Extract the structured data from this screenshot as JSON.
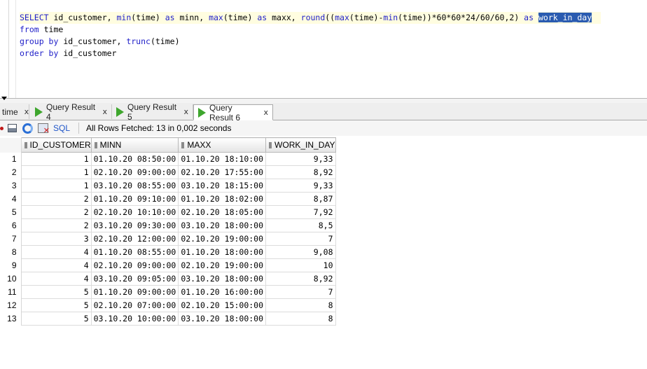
{
  "editor": {
    "lines": [
      [
        {
          "t": "SELECT",
          "c": "kw"
        },
        {
          "t": " id_customer, ",
          "c": "plain"
        },
        {
          "t": "min",
          "c": "fn"
        },
        {
          "t": "(time) ",
          "c": "plain"
        },
        {
          "t": "as",
          "c": "kw"
        },
        {
          "t": " minn, ",
          "c": "plain"
        },
        {
          "t": "max",
          "c": "fn"
        },
        {
          "t": "(time) ",
          "c": "plain"
        },
        {
          "t": "as",
          "c": "kw"
        },
        {
          "t": " maxx, ",
          "c": "plain"
        },
        {
          "t": "round",
          "c": "fn"
        },
        {
          "t": "((",
          "c": "plain"
        },
        {
          "t": "max",
          "c": "fn"
        },
        {
          "t": "(time)-",
          "c": "plain"
        },
        {
          "t": "min",
          "c": "fn"
        },
        {
          "t": "(time))*60*60*24/60/60,2) ",
          "c": "plain"
        },
        {
          "t": "as",
          "c": "kw"
        },
        {
          "t": " ",
          "c": "plain"
        },
        {
          "t": "work_in_day",
          "c": "sel"
        }
      ],
      [
        {
          "t": "from",
          "c": "kw"
        },
        {
          "t": " time",
          "c": "plain"
        }
      ],
      [
        {
          "t": "group by",
          "c": "kw"
        },
        {
          "t": " id_customer, ",
          "c": "plain"
        },
        {
          "t": "trunc",
          "c": "fn"
        },
        {
          "t": "(time)",
          "c": "plain"
        }
      ],
      [
        {
          "t": "order by",
          "c": "kw"
        },
        {
          "t": " id_customer",
          "c": "plain"
        }
      ]
    ]
  },
  "tabs": [
    {
      "label": "time",
      "active": false,
      "icon": false
    },
    {
      "label": "Query Result 4",
      "active": false,
      "icon": true
    },
    {
      "label": "Query Result 5",
      "active": false,
      "icon": true
    },
    {
      "label": "Query Result 6",
      "active": true,
      "icon": true
    }
  ],
  "tab_close_glyph": "x",
  "toolbar": {
    "sql_label": "SQL",
    "status": "All Rows Fetched: 13 in 0,002 seconds",
    "icons": [
      "pin-icon",
      "print-icon",
      "refresh-icon",
      "clear-icon"
    ]
  },
  "grid": {
    "columns": [
      "ID_CUSTOMER",
      "MINN",
      "MAXX",
      "WORK_IN_DAY"
    ],
    "rows": [
      {
        "n": "1",
        "id": "1",
        "minn": "01.10.20 08:50:00",
        "maxx": "01.10.20 18:10:00",
        "work": "9,33"
      },
      {
        "n": "2",
        "id": "1",
        "minn": "02.10.20 09:00:00",
        "maxx": "02.10.20 17:55:00",
        "work": "8,92"
      },
      {
        "n": "3",
        "id": "1",
        "minn": "03.10.20 08:55:00",
        "maxx": "03.10.20 18:15:00",
        "work": "9,33"
      },
      {
        "n": "4",
        "id": "2",
        "minn": "01.10.20 09:10:00",
        "maxx": "01.10.20 18:02:00",
        "work": "8,87"
      },
      {
        "n": "5",
        "id": "2",
        "minn": "02.10.20 10:10:00",
        "maxx": "02.10.20 18:05:00",
        "work": "7,92"
      },
      {
        "n": "6",
        "id": "2",
        "minn": "03.10.20 09:30:00",
        "maxx": "03.10.20 18:00:00",
        "work": "8,5"
      },
      {
        "n": "7",
        "id": "3",
        "minn": "02.10.20 12:00:00",
        "maxx": "02.10.20 19:00:00",
        "work": "7"
      },
      {
        "n": "8",
        "id": "4",
        "minn": "01.10.20 08:55:00",
        "maxx": "01.10.20 18:00:00",
        "work": "9,08"
      },
      {
        "n": "9",
        "id": "4",
        "minn": "02.10.20 09:00:00",
        "maxx": "02.10.20 19:00:00",
        "work": "10"
      },
      {
        "n": "10",
        "id": "4",
        "minn": "03.10.20 09:05:00",
        "maxx": "03.10.20 18:00:00",
        "work": "8,92"
      },
      {
        "n": "11",
        "id": "5",
        "minn": "01.10.20 09:00:00",
        "maxx": "01.10.20 16:00:00",
        "work": "7"
      },
      {
        "n": "12",
        "id": "5",
        "minn": "02.10.20 07:00:00",
        "maxx": "02.10.20 15:00:00",
        "work": "8"
      },
      {
        "n": "13",
        "id": "5",
        "minn": "03.10.20 10:00:00",
        "maxx": "03.10.20 18:00:00",
        "work": "8"
      }
    ]
  },
  "colors": {
    "keyword": "#1e1ec8",
    "selection": "#2a5bb0",
    "run_icon": "#3ea62d",
    "link": "#1f55c8"
  }
}
